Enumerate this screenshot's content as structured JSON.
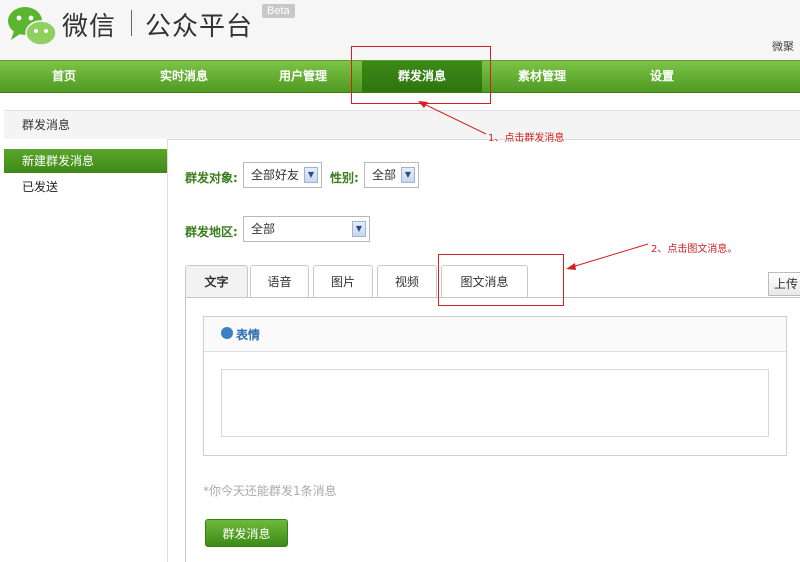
{
  "header": {
    "brand": "微信",
    "brand_sub": "公众平台",
    "beta": "Beta",
    "username": "微聚"
  },
  "nav": {
    "items": [
      {
        "label": "首页"
      },
      {
        "label": "实时消息"
      },
      {
        "label": "用户管理"
      },
      {
        "label": "群发消息"
      },
      {
        "label": "素材管理"
      },
      {
        "label": "设置"
      }
    ],
    "active_index": 3
  },
  "panel": {
    "title": "群发消息"
  },
  "sidebar": {
    "items": [
      {
        "label": "新建群发消息"
      },
      {
        "label": "已发送"
      }
    ]
  },
  "form": {
    "target_label": "群发对象:",
    "target_value": "全部好友",
    "gender_label": "性别:",
    "gender_value": "全部",
    "region_label": "群发地区:",
    "region_value": "全部"
  },
  "tabs": [
    {
      "label": "文字"
    },
    {
      "label": "语音"
    },
    {
      "label": "图片"
    },
    {
      "label": "视频"
    },
    {
      "label": "图文消息"
    }
  ],
  "upload_label": "上传",
  "editor": {
    "emoji_label": "表情"
  },
  "hint": "*你今天还能群发1条消息",
  "send_button": "群发消息",
  "annotations": {
    "step1": "1、点击群发消息",
    "step2": "2、点击图文消息。"
  },
  "colors": {
    "nav_green": "#4f9a22",
    "annotation_red": "#d42020"
  }
}
